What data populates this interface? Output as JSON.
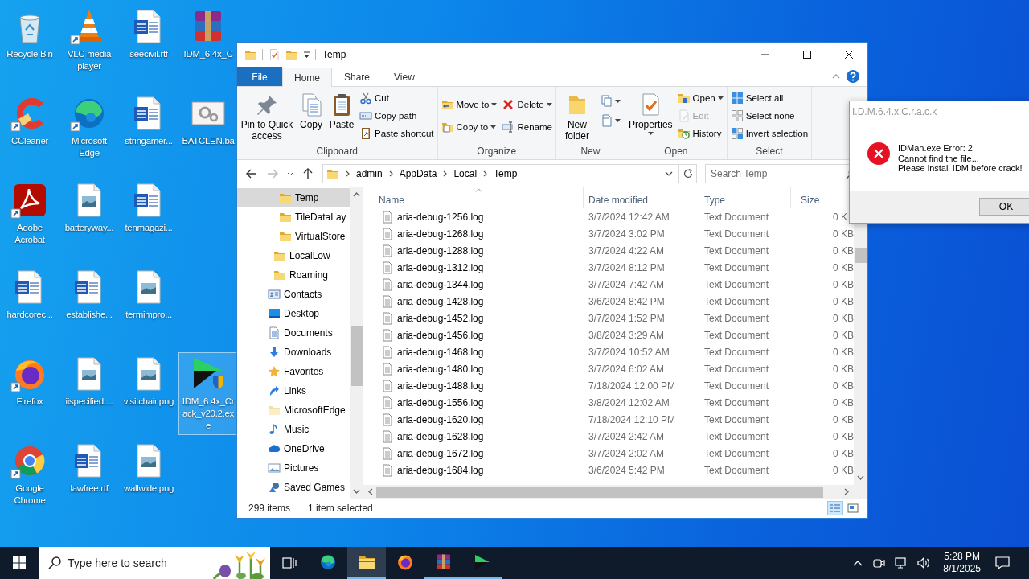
{
  "desktop": {
    "rows": [
      [
        {
          "label": "Recycle Bin",
          "kind": "bin",
          "shortcut": false,
          "selected": false
        },
        {
          "label": "VLC media player",
          "kind": "vlc",
          "shortcut": true,
          "selected": false
        },
        {
          "label": "seecivil.rtf",
          "kind": "word",
          "shortcut": false,
          "selected": false
        },
        {
          "label": "IDM_6.4x_C",
          "kind": "winrar",
          "shortcut": false,
          "selected": false
        }
      ],
      [
        {
          "label": "CCleaner",
          "kind": "ccleaner",
          "shortcut": true,
          "selected": false
        },
        {
          "label": "Microsoft Edge",
          "kind": "edge",
          "shortcut": true,
          "selected": false
        },
        {
          "label": "stringamer...",
          "kind": "word",
          "shortcut": false,
          "selected": false
        },
        {
          "label": "BATCLEN.ba",
          "kind": "batch",
          "shortcut": false,
          "selected": false
        }
      ],
      [
        {
          "label": "Adobe Acrobat",
          "kind": "acrobat",
          "shortcut": true,
          "selected": false
        },
        {
          "label": "batteryway...",
          "kind": "image",
          "shortcut": false,
          "selected": false
        },
        {
          "label": "tenmagazi...",
          "kind": "word",
          "shortcut": false,
          "selected": false
        }
      ],
      [
        {
          "label": "hardcorec...",
          "kind": "word",
          "shortcut": false,
          "selected": false
        },
        {
          "label": "establishe...",
          "kind": "word",
          "shortcut": false,
          "selected": false
        },
        {
          "label": "termimpro...",
          "kind": "image",
          "shortcut": false,
          "selected": false
        }
      ],
      [
        {
          "label": "Firefox",
          "kind": "firefox",
          "shortcut": true,
          "selected": false
        },
        {
          "label": "iispecified....",
          "kind": "image",
          "shortcut": false,
          "selected": false
        },
        {
          "label": "visitchair.png",
          "kind": "image",
          "shortcut": false,
          "selected": false
        },
        {
          "label": "IDM_6.4x_Crack_v20.2.exe",
          "kind": "installer",
          "shortcut": false,
          "selected": true
        }
      ],
      [
        {
          "label": "Google Chrome",
          "kind": "chrome",
          "shortcut": true,
          "selected": false
        },
        {
          "label": "lawfree.rtf",
          "kind": "word",
          "shortcut": false,
          "selected": false
        },
        {
          "label": "wallwide.png",
          "kind": "image",
          "shortcut": false,
          "selected": false
        }
      ]
    ]
  },
  "explorer": {
    "title": "Temp",
    "tabs": [
      {
        "label": "File",
        "kind": "file",
        "selected": false
      },
      {
        "label": "Home",
        "kind": "tab",
        "selected": true
      },
      {
        "label": "Share",
        "kind": "tab",
        "selected": false
      },
      {
        "label": "View",
        "kind": "tab",
        "selected": false
      }
    ],
    "ribbon": {
      "groups": [
        {
          "label": "Clipboard",
          "columns": [
            [
              {
                "kind": "large",
                "label": "Pin to Quick access",
                "menu": false,
                "disabled": false
              }
            ],
            [
              {
                "kind": "large",
                "label": "Copy",
                "menu": false,
                "disabled": false
              }
            ],
            [
              {
                "kind": "large",
                "label": "Paste",
                "menu": false,
                "disabled": false
              }
            ],
            [
              {
                "kind": "small",
                "label": "Cut",
                "menu": false,
                "disabled": false
              },
              {
                "kind": "small",
                "label": "Copy path",
                "menu": false,
                "disabled": false
              },
              {
                "kind": "small",
                "label": "Paste shortcut",
                "menu": false,
                "disabled": false
              }
            ]
          ]
        },
        {
          "label": "Organize",
          "columns": [
            [
              {
                "kind": "small",
                "label": "Move to",
                "menu": true,
                "disabled": false
              },
              {
                "kind": "small",
                "label": "Copy to",
                "menu": true,
                "disabled": false
              }
            ],
            [
              {
                "kind": "small",
                "label": "Delete",
                "menu": true,
                "disabled": false
              },
              {
                "kind": "small",
                "label": "Rename",
                "menu": false,
                "disabled": false
              }
            ]
          ]
        },
        {
          "label": "New",
          "columns": [
            [
              {
                "kind": "large",
                "label": "New folder",
                "menu": false,
                "disabled": false
              }
            ],
            [
              {
                "kind": "icon",
                "menu": true,
                "disabled": false
              },
              {
                "kind": "icon",
                "menu": true,
                "disabled": false
              }
            ]
          ]
        },
        {
          "label": "Open",
          "columns": [
            [
              {
                "kind": "large",
                "label": "Properties",
                "menu": true,
                "disabled": false
              }
            ],
            [
              {
                "kind": "small",
                "label": "Open",
                "menu": true,
                "disabled": false
              },
              {
                "kind": "small",
                "label": "Edit",
                "menu": false,
                "disabled": true
              },
              {
                "kind": "small",
                "label": "History",
                "menu": false,
                "disabled": false
              }
            ]
          ]
        },
        {
          "label": "Select",
          "columns": [
            [
              {
                "kind": "small",
                "label": "Select all",
                "menu": false,
                "disabled": false
              },
              {
                "kind": "small",
                "label": "Select none",
                "menu": false,
                "disabled": false
              },
              {
                "kind": "small",
                "label": "Invert selection",
                "menu": false,
                "disabled": false
              }
            ]
          ]
        }
      ]
    },
    "address": {
      "path": [
        "admin",
        "AppData",
        "Local",
        "Temp"
      ],
      "search_placeholder": "Search Temp"
    },
    "nav_pane": {
      "items": [
        {
          "children": [
            {
              "children": [
                {
                  "label": "Temp",
                  "kind": "folder",
                  "selected": true
                },
                {
                  "label": "TileDataLay",
                  "kind": "folder",
                  "selected": false
                },
                {
                  "label": "VirtualStore",
                  "kind": "folder",
                  "selected": false
                }
              ]
            },
            {
              "label": "LocalLow",
              "kind": "folder",
              "selected": false
            },
            {
              "label": "Roaming",
              "kind": "folder",
              "selected": false
            }
          ]
        },
        {
          "label": "Contacts",
          "kind": "contacts",
          "selected": false
        },
        {
          "label": "Desktop",
          "kind": "desktop",
          "selected": false
        },
        {
          "label": "Documents",
          "kind": "documents",
          "selected": false
        },
        {
          "label": "Downloads",
          "kind": "downloads",
          "selected": false
        },
        {
          "label": "Favorites",
          "kind": "favorites",
          "selected": false
        },
        {
          "label": "Links",
          "kind": "links",
          "selected": false
        },
        {
          "label": "MicrosoftEdge",
          "kind": "hidden",
          "selected": false
        },
        {
          "label": "Music",
          "kind": "music",
          "selected": false
        },
        {
          "label": "OneDrive",
          "kind": "onedrive",
          "selected": false
        },
        {
          "label": "Pictures",
          "kind": "pictures",
          "selected": false
        },
        {
          "label": "Saved Games",
          "kind": "games",
          "selected": false
        }
      ]
    },
    "file_list": {
      "columns": [
        {
          "label": "Name",
          "sorted": true
        },
        {
          "label": "Date modified",
          "sorted": false
        },
        {
          "label": "Type",
          "sorted": false
        },
        {
          "label": "Size",
          "sorted": false
        }
      ],
      "rows": [
        {
          "name": "aria-debug-1256.log",
          "date": "3/7/2024 12:42 AM",
          "type": "Text Document",
          "size": "0 K",
          "selected": false
        },
        {
          "name": "aria-debug-1268.log",
          "date": "3/7/2024 3:02 PM",
          "type": "Text Document",
          "size": "0 KB",
          "selected": false
        },
        {
          "name": "aria-debug-1288.log",
          "date": "3/7/2024 4:22 AM",
          "type": "Text Document",
          "size": "0 KB",
          "selected": false
        },
        {
          "name": "aria-debug-1312.log",
          "date": "3/7/2024 8:12 PM",
          "type": "Text Document",
          "size": "0 KB",
          "selected": false
        },
        {
          "name": "aria-debug-1344.log",
          "date": "3/7/2024 7:42 AM",
          "type": "Text Document",
          "size": "0 KB",
          "selected": false
        },
        {
          "name": "aria-debug-1428.log",
          "date": "3/6/2024 8:42 PM",
          "type": "Text Document",
          "size": "0 KB",
          "selected": false
        },
        {
          "name": "aria-debug-1452.log",
          "date": "3/7/2024 1:52 PM",
          "type": "Text Document",
          "size": "0 KB",
          "selected": false
        },
        {
          "name": "aria-debug-1456.log",
          "date": "3/8/2024 3:29 AM",
          "type": "Text Document",
          "size": "0 KB",
          "selected": false
        },
        {
          "name": "aria-debug-1468.log",
          "date": "3/7/2024 10:52 AM",
          "type": "Text Document",
          "size": "0 KB",
          "selected": false
        },
        {
          "name": "aria-debug-1480.log",
          "date": "3/7/2024 6:02 AM",
          "type": "Text Document",
          "size": "0 KB",
          "selected": false
        },
        {
          "name": "aria-debug-1488.log",
          "date": "7/18/2024 12:00 PM",
          "type": "Text Document",
          "size": "0 KB",
          "selected": false
        },
        {
          "name": "aria-debug-1556.log",
          "date": "3/8/2024 12:02 AM",
          "type": "Text Document",
          "size": "0 KB",
          "selected": false
        },
        {
          "name": "aria-debug-1620.log",
          "date": "7/18/2024 12:10 PM",
          "type": "Text Document",
          "size": "0 KB",
          "selected": false
        },
        {
          "name": "aria-debug-1628.log",
          "date": "3/7/2024 2:42 AM",
          "type": "Text Document",
          "size": "0 KB",
          "selected": false
        },
        {
          "name": "aria-debug-1672.log",
          "date": "3/7/2024 2:02 AM",
          "type": "Text Document",
          "size": "0 KB",
          "selected": false
        },
        {
          "name": "aria-debug-1684.log",
          "date": "3/6/2024 5:42 PM",
          "type": "Text Document",
          "size": "0 KB",
          "selected": false
        }
      ]
    },
    "status_bar": {
      "item_count": "299 items",
      "selection": "1 item selected",
      "views": [
        {
          "kind": "details",
          "selected": true
        },
        {
          "kind": "tiles",
          "selected": false
        }
      ]
    }
  },
  "dialog": {
    "title": "I.D.M.6.4.x.C.r.a.c.k",
    "message": "IDMan.exe Error: 2\nCannot find the file...\nPlease install IDM before crack!",
    "button": "OK"
  },
  "taskbar": {
    "search_placeholder": "Type here to search",
    "apps": [
      {
        "kind": "edge",
        "active": false,
        "running": false
      },
      {
        "kind": "explorer",
        "active": true,
        "running": true
      },
      {
        "kind": "firefox",
        "active": false,
        "running": false
      },
      {
        "kind": "winrar",
        "active": false,
        "running": true
      },
      {
        "kind": "idm",
        "active": false,
        "running": true
      }
    ],
    "clock": {
      "time": "5:28 PM",
      "date": "8/1/2025"
    }
  }
}
